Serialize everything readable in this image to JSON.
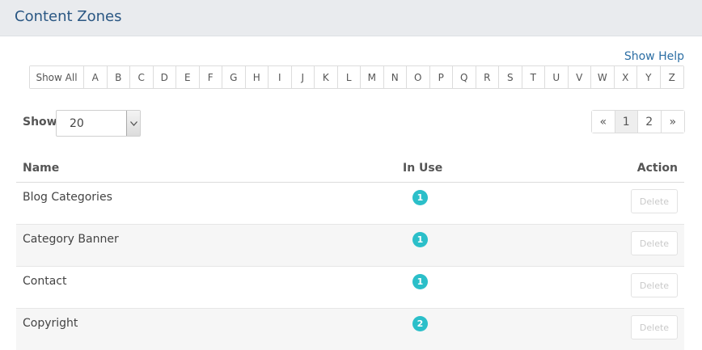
{
  "header": {
    "title": "Content Zones"
  },
  "help_link": "Show Help",
  "alpha_filter": {
    "all_label": "Show All",
    "letters": [
      "A",
      "B",
      "C",
      "D",
      "E",
      "F",
      "G",
      "H",
      "I",
      "J",
      "K",
      "L",
      "M",
      "N",
      "O",
      "P",
      "Q",
      "R",
      "S",
      "T",
      "U",
      "V",
      "W",
      "X",
      "Y",
      "Z"
    ]
  },
  "page_size": {
    "label": "Show",
    "value": "20"
  },
  "pagination": {
    "prev": "«",
    "pages": [
      "1",
      "2"
    ],
    "current": "1",
    "next": "»"
  },
  "table": {
    "columns": {
      "name": "Name",
      "in_use": "In Use",
      "action": "Action"
    },
    "rows": [
      {
        "name": "Blog Categories",
        "in_use": "1",
        "action": "Delete"
      },
      {
        "name": "Category Banner",
        "in_use": "1",
        "action": "Delete"
      },
      {
        "name": "Contact",
        "in_use": "1",
        "action": "Delete"
      },
      {
        "name": "Copyright",
        "in_use": "2",
        "action": "Delete"
      }
    ]
  },
  "colors": {
    "title": "#2a5783",
    "link": "#2c6ea4",
    "badge": "#2bbfc9"
  }
}
